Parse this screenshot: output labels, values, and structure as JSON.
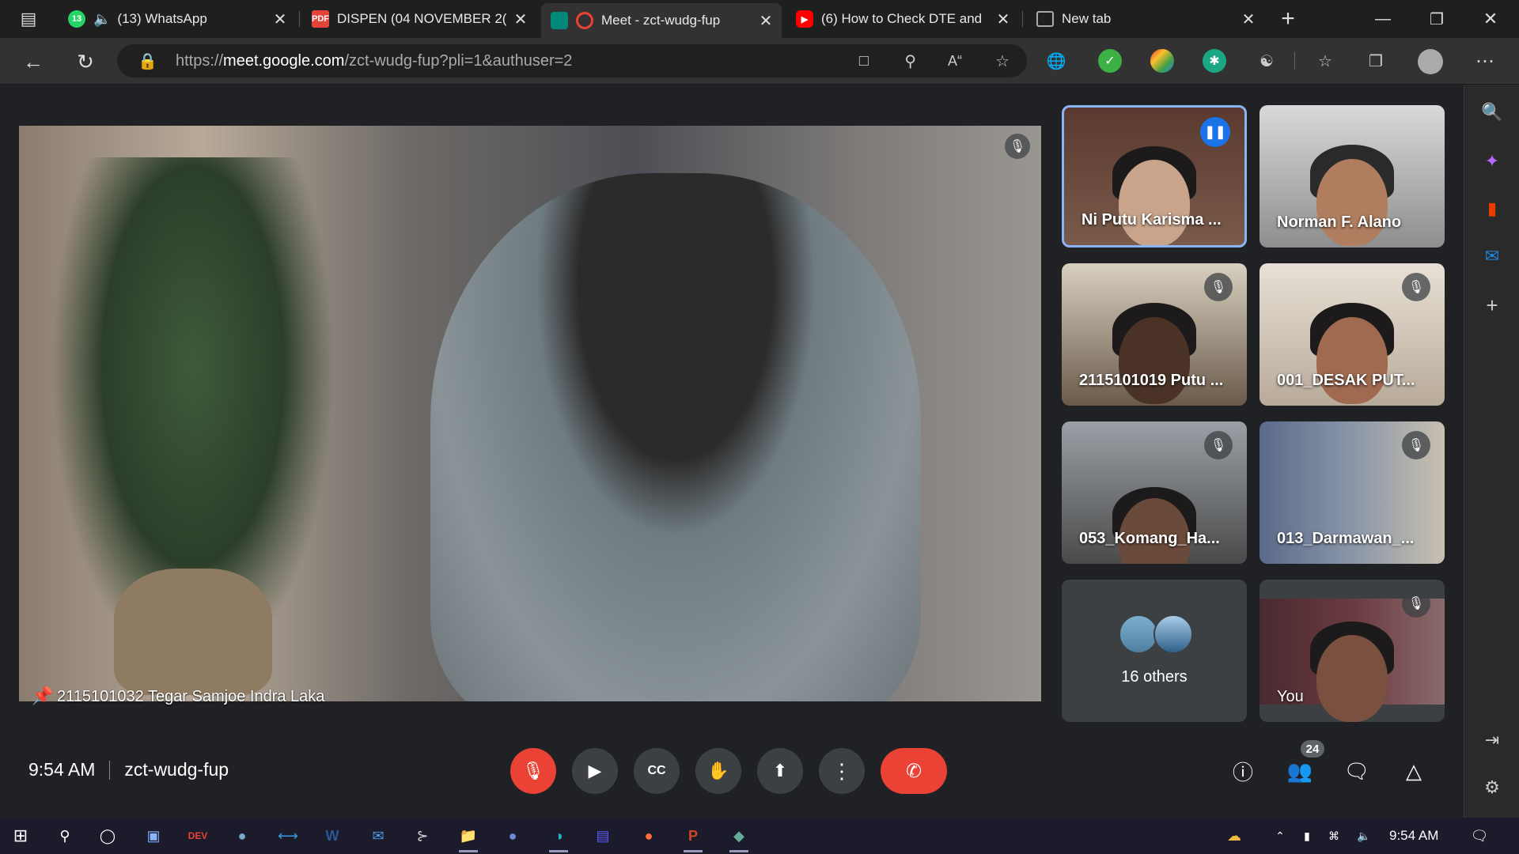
{
  "browser": {
    "tabs": [
      {
        "title": "(13) WhatsApp",
        "badge": "13"
      },
      {
        "title": "DISPEN (04 NOVEMBER 2(",
        "icon": "pdf-icon"
      },
      {
        "title": "Meet - zct-wudg-fup",
        "active": true
      },
      {
        "title": "(6) How to Check DTE and",
        "icon": "youtube-icon"
      },
      {
        "title": "New tab"
      }
    ],
    "url_prefix": "https://",
    "url_host": "meet.google.com",
    "url_path": "/zct-wudg-fup?pli=1&authuser=2"
  },
  "meet": {
    "main_participant": "2115101032 Tegar Samjoe Indra Laka",
    "tiles": [
      {
        "name": "Ni Putu Karisma ...",
        "speaking": true
      },
      {
        "name": "Norman F. Alano",
        "muted": false
      },
      {
        "name": "2115101019 Putu ...",
        "muted": true
      },
      {
        "name": "001_DESAK PUT...",
        "muted": true
      },
      {
        "name": "053_Komang_Ha...",
        "muted": true
      },
      {
        "name": "013_Darmawan_...",
        "muted": true
      }
    ],
    "others_label": "16 others",
    "self_label": "You",
    "time": "9:54 AM",
    "meeting_code": "zct-wudg-fup",
    "people_count": "24"
  },
  "taskbar": {
    "clock": "9:54 AM"
  },
  "colors": {
    "red": "#ea4335",
    "blue": "#1a73e8",
    "surface": "#202124",
    "button": "#3c4043"
  }
}
